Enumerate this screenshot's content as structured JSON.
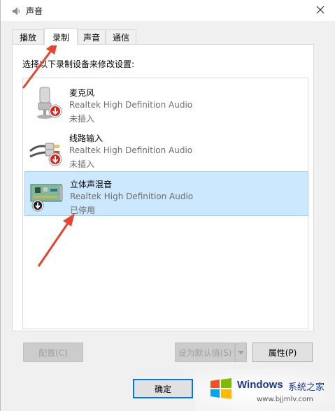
{
  "window": {
    "title": "声音"
  },
  "tabs": [
    {
      "label": "播放"
    },
    {
      "label": "录制"
    },
    {
      "label": "声音"
    },
    {
      "label": "通信"
    }
  ],
  "instruction": "选择以下录制设备来修改设置:",
  "devices": [
    {
      "name": "麦克风",
      "driver": "Realtek High Definition Audio",
      "status": "未插入",
      "icon": "microphone-icon",
      "badge": "disconnected-badge"
    },
    {
      "name": "线路输入",
      "driver": "Realtek High Definition Audio",
      "status": "未插入",
      "icon": "line-in-cable-icon",
      "badge": "disconnected-badge"
    },
    {
      "name": "立体声混音",
      "driver": "Realtek High Definition Audio",
      "status": "已停用",
      "icon": "sound-card-icon",
      "badge": "disabled-badge"
    }
  ],
  "buttons": {
    "configure": "配置(C)",
    "set_default": "设为默认值(S)",
    "properties": "属性(P)",
    "ok": "确定"
  },
  "watermark": {
    "brand": "Windows",
    "site_name": "系统之家",
    "url": "www.bjjmlv.com"
  },
  "colors": {
    "selection_bg": "#cce8ff",
    "selection_border": "#99d1ff",
    "annotation_arrow": "#e8432d",
    "primary_border": "#0078d7"
  }
}
